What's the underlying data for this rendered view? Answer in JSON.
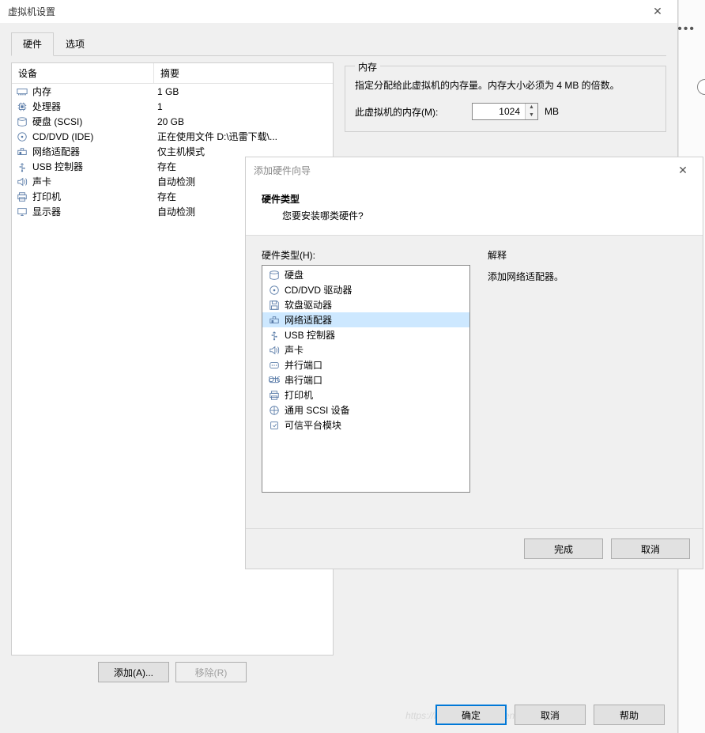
{
  "window": {
    "title": "虚拟机设置",
    "tabs": {
      "hardware": "硬件",
      "options": "选项"
    }
  },
  "device_table": {
    "head_device": "设备",
    "head_summary": "摘要",
    "rows": [
      {
        "icon": "memory",
        "name": "内存",
        "summary": "1 GB"
      },
      {
        "icon": "cpu",
        "name": "处理器",
        "summary": "1"
      },
      {
        "icon": "disk",
        "name": "硬盘 (SCSI)",
        "summary": "20 GB"
      },
      {
        "icon": "cd",
        "name": "CD/DVD (IDE)",
        "summary": "正在使用文件 D:\\迅雷下载\\..."
      },
      {
        "icon": "net",
        "name": "网络适配器",
        "summary": "仅主机模式"
      },
      {
        "icon": "usb",
        "name": "USB 控制器",
        "summary": "存在"
      },
      {
        "icon": "sound",
        "name": "声卡",
        "summary": "自动检测"
      },
      {
        "icon": "printer",
        "name": "打印机",
        "summary": "存在"
      },
      {
        "icon": "display",
        "name": "显示器",
        "summary": "自动检测"
      }
    ]
  },
  "device_buttons": {
    "add": "添加(A)...",
    "remove": "移除(R)"
  },
  "memory": {
    "legend": "内存",
    "desc": "指定分配给此虚拟机的内存量。内存大小必须为 4 MB 的倍数。",
    "field_label": "此虚拟机的内存(M):",
    "value": "1024",
    "unit": "MB"
  },
  "footer": {
    "ok": "确定",
    "cancel": "取消",
    "help": "帮助"
  },
  "watermark": "https://blog.csdn.net/FriendCTO博客",
  "wizard": {
    "title": "添加硬件向导",
    "heading": "硬件类型",
    "subheading": "您要安装哪类硬件?",
    "list_label": "硬件类型(H):",
    "explain_label": "解释",
    "explain_text": "添加网络适配器。",
    "items": [
      {
        "icon": "disk",
        "label": "硬盘"
      },
      {
        "icon": "cd",
        "label": "CD/DVD 驱动器"
      },
      {
        "icon": "floppy",
        "label": "软盘驱动器"
      },
      {
        "icon": "net",
        "label": "网络适配器",
        "selected": true
      },
      {
        "icon": "usb",
        "label": "USB 控制器"
      },
      {
        "icon": "sound",
        "label": "声卡"
      },
      {
        "icon": "parallel",
        "label": "并行端口"
      },
      {
        "icon": "serial",
        "label": "串行端口"
      },
      {
        "icon": "printer",
        "label": "打印机"
      },
      {
        "icon": "scsi",
        "label": "通用 SCSI 设备"
      },
      {
        "icon": "tpm",
        "label": "可信平台模块"
      }
    ],
    "buttons": {
      "finish": "完成",
      "cancel": "取消"
    }
  },
  "right_strip": {
    "dots": "•••"
  }
}
